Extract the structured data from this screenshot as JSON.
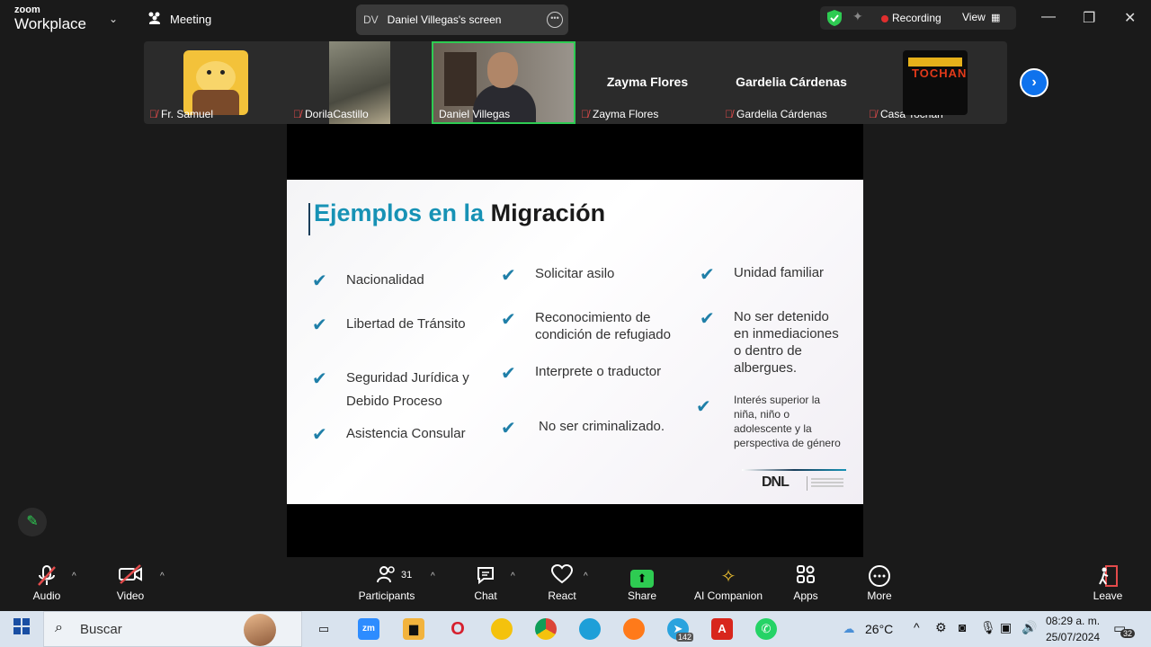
{
  "app": {
    "brand_small": "zoom",
    "brand_big": "Workplace",
    "meeting_label": "Meeting"
  },
  "screen_share": {
    "initials": "DV",
    "title": "Daniel Villegas's screen"
  },
  "status": {
    "recording": "Recording",
    "view": "View"
  },
  "participants_strip": [
    {
      "name": "Fr. Samuel",
      "muted": true
    },
    {
      "name": "DorilaCastillo",
      "muted": true
    },
    {
      "name": "Daniel Villegas",
      "muted": false,
      "active": true
    },
    {
      "name": "Zayma Flores",
      "muted": true,
      "display_name": "Zayma Flores"
    },
    {
      "name": "Gardelia Cárdenas",
      "muted": true,
      "display_name": "Gardelia Cárdenas"
    },
    {
      "name": "Casa Tochan",
      "muted": true
    }
  ],
  "slide": {
    "title_blue": "Ejemplos en la",
    "title_dark": "Migración",
    "col1": [
      "Nacionalidad",
      "Libertad de Tránsito",
      "Seguridad Jurídica y",
      "Debido Proceso",
      "Asistencia Consular"
    ],
    "col2": [
      "Solicitar asilo",
      "Reconocimiento de",
      "condición de refugiado",
      "Interprete o traductor",
      "No ser criminalizado."
    ],
    "col3": [
      "Unidad familiar",
      "No ser detenido",
      "en inmediaciones",
      "o dentro de",
      "albergues.",
      "Interés superior la",
      "niña, niño o",
      "adolescente y la",
      "perspectiva de género"
    ],
    "logo_text": "DNL"
  },
  "toolbar": {
    "audio": "Audio",
    "video": "Video",
    "participants": "Participants",
    "participants_count": "31",
    "chat": "Chat",
    "react": "React",
    "share": "Share",
    "ai": "AI Companion",
    "apps": "Apps",
    "more": "More",
    "leave": "Leave"
  },
  "taskbar": {
    "search_placeholder": "Buscar",
    "telegram_badge": "142",
    "weather": "26°C",
    "time": "08:29 a. m.",
    "date": "25/07/2024",
    "notifications": "32"
  }
}
